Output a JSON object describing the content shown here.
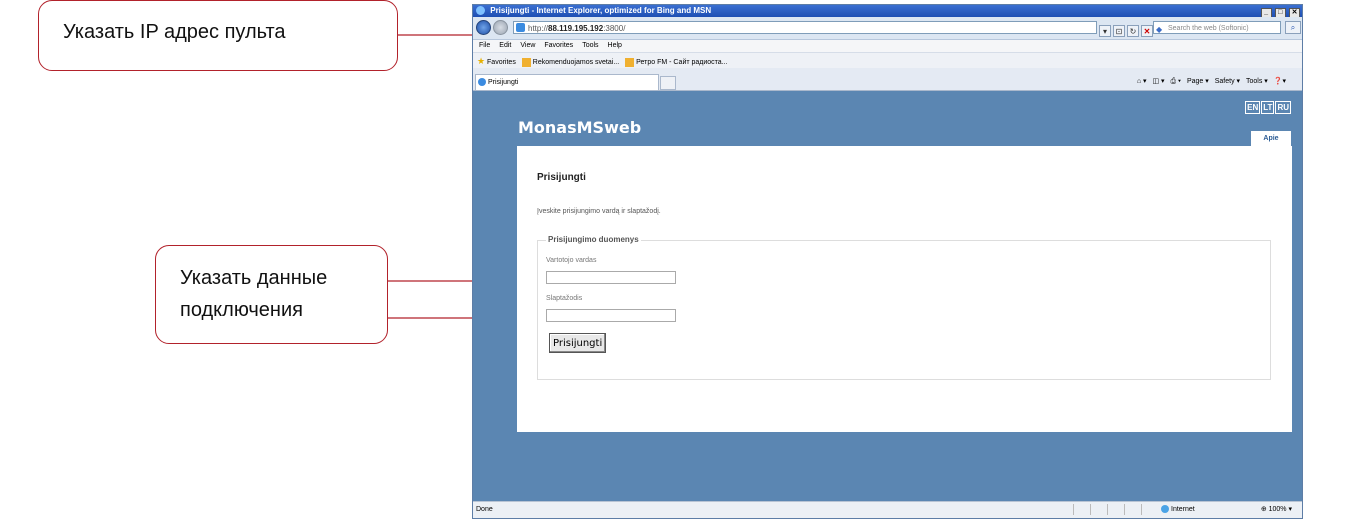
{
  "callouts": {
    "ip": "Указать IP адрес пульта",
    "credentials_line1": "Указать данные",
    "credentials_line2": "подключения"
  },
  "browser": {
    "title": "Prisijungti - Internet Explorer, optimized for Bing and MSN",
    "url_prefix": "http://",
    "url_host": "88.119.195.192",
    "url_port": ":3800/",
    "search_placeholder": "Search the web (Softonic)",
    "menu": [
      "File",
      "Edit",
      "View",
      "Favorites",
      "Tools",
      "Help"
    ],
    "favorites_label": "Favorites",
    "fav_items": [
      "Rekomenduojamos svetai...",
      "Ретро FM - Сайт радиоста..."
    ],
    "tab_title": "Prisijungti",
    "commands": [
      "Page ▾",
      "Safety ▾",
      "Tools ▾"
    ],
    "status_left": "Done",
    "status_zone": "Internet",
    "status_zoom": "100%"
  },
  "page": {
    "langs": [
      "EN",
      "LT",
      "RU"
    ],
    "brand": "MonasMSweb",
    "apie": "Apie",
    "heading": "Prisijungti",
    "intro": "Įveskite prisijungimo vardą ir slaptažodį.",
    "legend": "Prisijungimo duomenys",
    "username_label": "Vartotojo vardas",
    "password_label": "Slaptažodis",
    "login_button": "Prisijungti"
  },
  "colors": {
    "callout_border": "#b2222b",
    "page_background": "#5b86b2",
    "titlebar": "#1e4fb3"
  }
}
